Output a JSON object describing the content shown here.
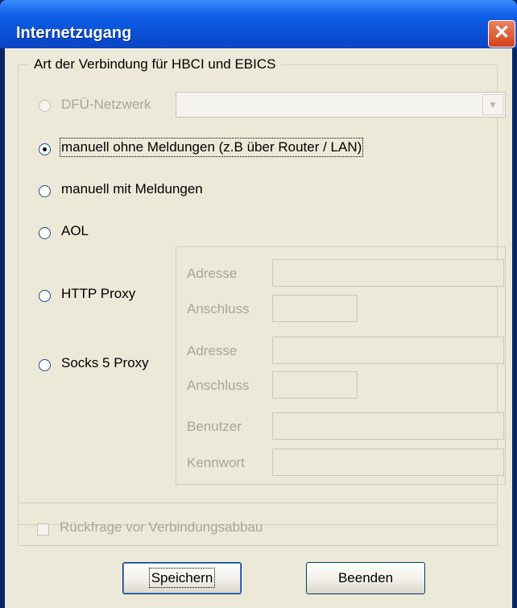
{
  "window": {
    "title": "Internetzugang",
    "close_label": "✕"
  },
  "group": {
    "legend": "Art der Verbindung für HBCI und EBICS"
  },
  "options": {
    "dfu": "DFÜ-Netzwerk",
    "manual_no_msg": "manuell ohne Meldungen (z.B über Router / LAN)",
    "manual_msg": "manuell mit Meldungen",
    "aol": "AOL",
    "http_proxy": "HTTP Proxy",
    "socks5": "Socks 5 Proxy"
  },
  "dfu_select": {
    "value": ""
  },
  "http_fields": {
    "address_label": "Adresse",
    "port_label": "Anschluss",
    "address_value": "",
    "port_value": ""
  },
  "socks_fields": {
    "address_label": "Adresse",
    "port_label": "Anschluss",
    "user_label": "Benutzer",
    "password_label": "Kennwort",
    "address_value": "",
    "port_value": "",
    "user_value": "",
    "password_value": ""
  },
  "confirm_checkbox": {
    "label": "Rückfrage vor Verbindungsabbau",
    "checked": false
  },
  "buttons": {
    "save": "Speichern",
    "exit": "Beenden"
  },
  "selected_option": "manual_no_msg"
}
